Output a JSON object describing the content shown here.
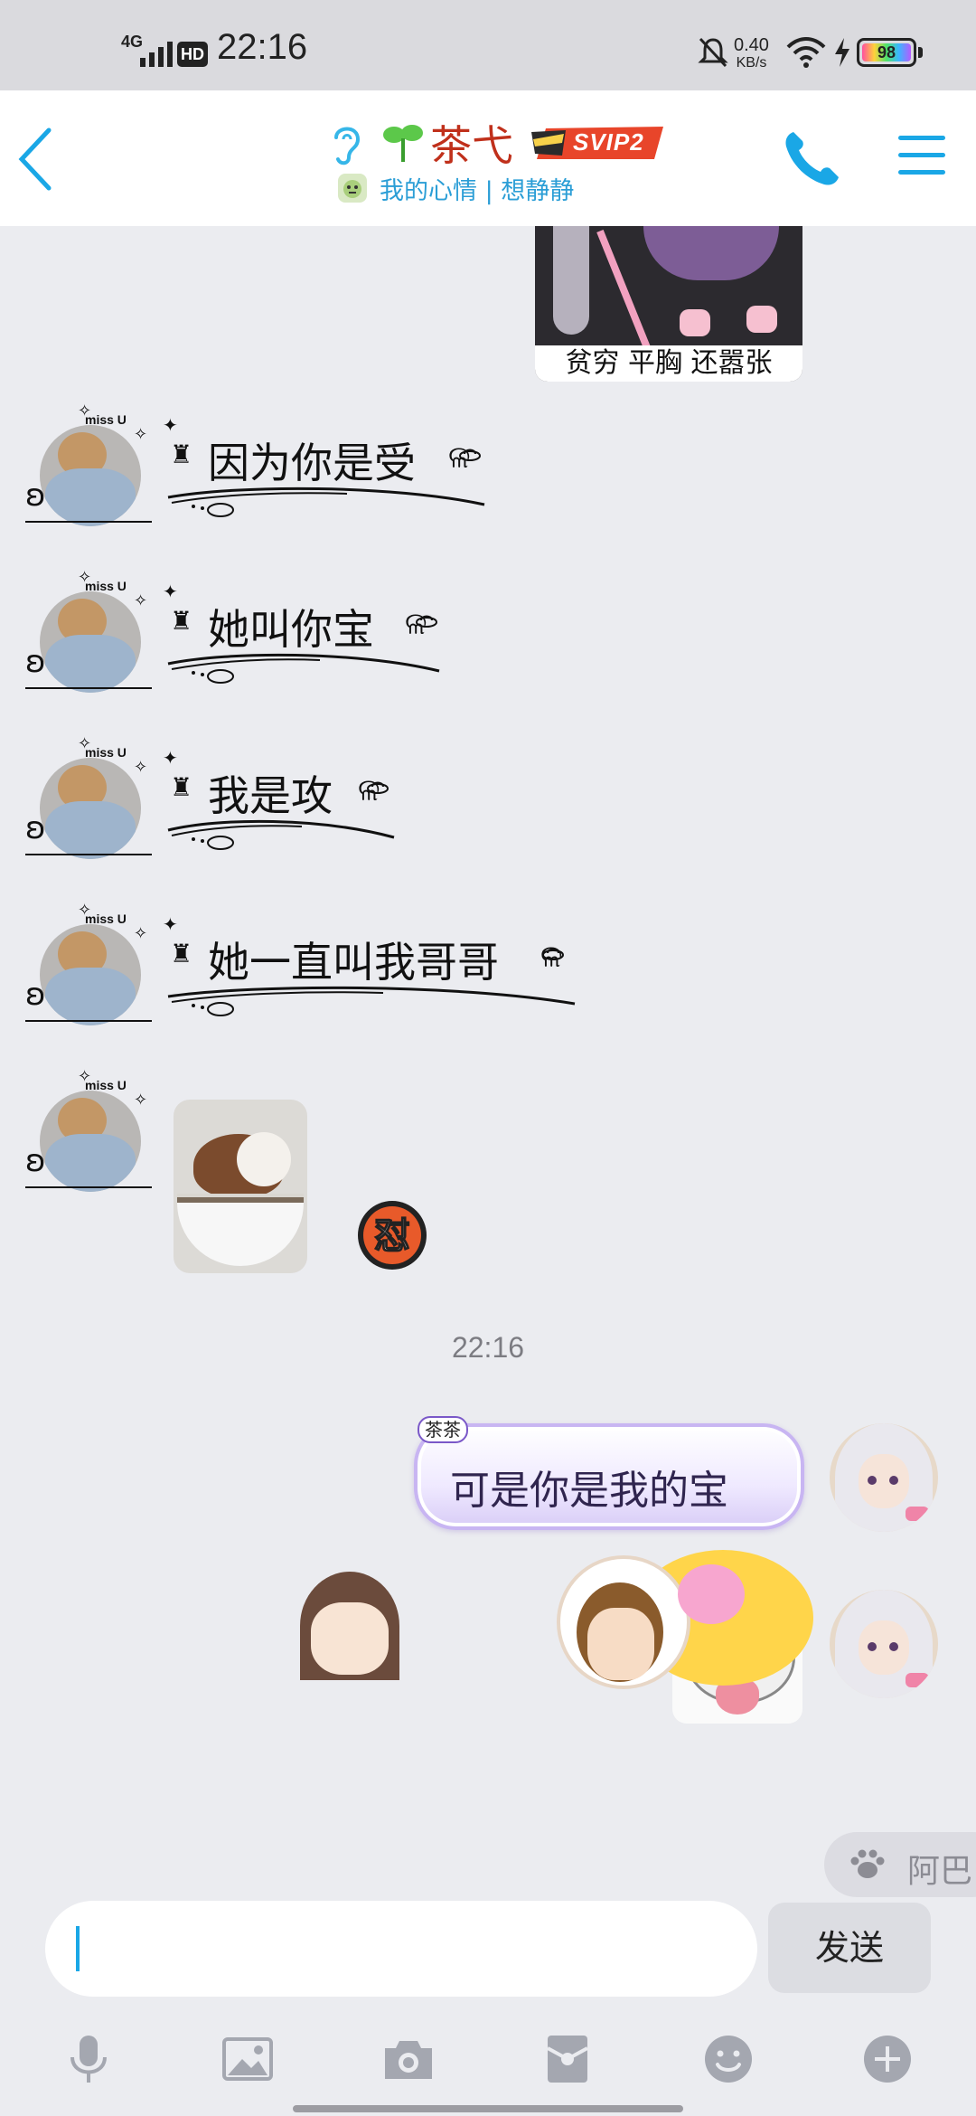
{
  "status_bar": {
    "network": "4G",
    "hd_badge": "HD",
    "time": "22:16",
    "speed_value": "0.40",
    "speed_unit": "KB/s",
    "battery": "98"
  },
  "header": {
    "contact_name": "茶弋",
    "vip_badge": "SVIP2",
    "status_text": "我的心情 | 想静静",
    "accent_color": "#1aa7e6"
  },
  "chat": {
    "top_sticker_caption": "贫穷 平胸 还嚣张",
    "incoming_messages": [
      {
        "text": "因为你是受"
      },
      {
        "text": "她叫你宝"
      },
      {
        "text": "我是攻"
      },
      {
        "text": "她一直叫我哥哥"
      }
    ],
    "reaction_glyph": "怼",
    "timestamp": "22:16",
    "outgoing": {
      "bubble_tag": "茶茶",
      "text": "可是你是我的宝"
    },
    "side_chip_text": "阿巴"
  },
  "input": {
    "value": "",
    "send_label": "发送"
  },
  "toolbar": {
    "icons": [
      "microphone-icon",
      "image-icon",
      "camera-icon",
      "red-packet-icon",
      "emoji-icon",
      "plus-icon"
    ]
  }
}
